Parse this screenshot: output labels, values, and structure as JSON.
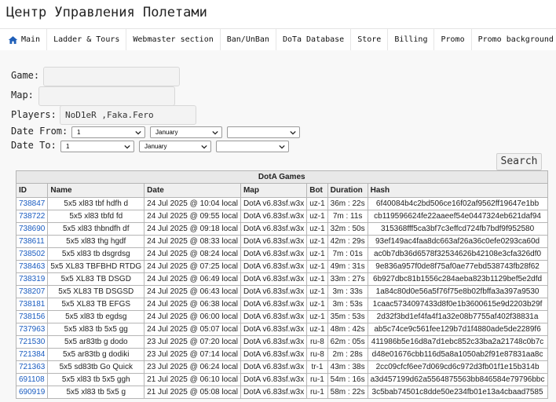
{
  "app": {
    "title": "Центр Управления Полетами"
  },
  "nav": {
    "items": [
      {
        "label": "Main",
        "icon": "home-icon"
      },
      {
        "label": "Ladder & Tours"
      },
      {
        "label": "Webmaster section"
      },
      {
        "label": "Ban/UnBan"
      },
      {
        "label": "DoTa Database"
      },
      {
        "label": "Store"
      },
      {
        "label": "Billing"
      },
      {
        "label": "Promo"
      },
      {
        "label": "Promo background"
      }
    ]
  },
  "filters": {
    "game_label": "Game:",
    "game_value": "",
    "map_label": "Map:",
    "map_value": "",
    "players_label": "Players:",
    "players_value": "NoD1eR ,Faka.Fero",
    "date_from_label": "Date From:",
    "date_from": {
      "day": "1",
      "month": "January",
      "year": ""
    },
    "date_to_label": "Date To:",
    "date_to": {
      "day": "1",
      "month": "January",
      "year": ""
    },
    "search_button": "Search"
  },
  "table": {
    "caption": "DotA Games",
    "headers": [
      "ID",
      "Name",
      "Date",
      "Map",
      "Bot",
      "Duration",
      "Hash"
    ],
    "rows": [
      [
        "738847",
        "5x5 xl83 tbf hdfh d",
        "24 Jul 2025 @ 10:04 local",
        "DotA v6.83sf.w3x",
        "uz-1",
        "36m : 22s",
        "6f40084b4c2bd506ce16f02af9562ff19647e1bb"
      ],
      [
        "738722",
        "5x5 xl83 tbfd fd",
        "24 Jul 2025 @ 09:55 local",
        "DotA v6.83sf.w3x",
        "uz-1",
        "7m : 11s",
        "cb119596624fe22aaeef54e0447324eb621daf94"
      ],
      [
        "738690",
        "5x5 xl83 thbndfh df",
        "24 Jul 2025 @ 09:18 local",
        "DotA v6.83sf.w3x",
        "uz-1",
        "32m : 50s",
        "315368fff5ca3bf7c3effcd724fb7bdf9f952580"
      ],
      [
        "738611",
        "5x5 xl83 thg hgdf",
        "24 Jul 2025 @ 08:33 local",
        "DotA v6.83sf.w3x",
        "uz-1",
        "42m : 29s",
        "93ef149ac4faa8dc663af26a36c0efe0293ca60d"
      ],
      [
        "738502",
        "5x5 xl83 tb dsgrdsg",
        "24 Jul 2025 @ 08:24 local",
        "DotA v6.83sf.w3x",
        "uz-1",
        "7m : 01s",
        "ac0b7db36d6578f32534626b42108e3cfa326df0"
      ],
      [
        "738463",
        "5x5 XL83 TBFBHD RTDG",
        "24 Jul 2025 @ 07:25 local",
        "DotA v6.83sf.w3x",
        "uz-1",
        "49m : 31s",
        "9e836a957f0de8f75af0ae77ebd538743fb28f62"
      ],
      [
        "738319",
        "5x5 XL83 TB DSGD",
        "24 Jul 2025 @ 06:49 local",
        "DotA v6.83sf.w3x",
        "uz-1",
        "33m : 27s",
        "6b927dbc81b1556c284aeba823b1129bef5e2dfd"
      ],
      [
        "738207",
        "5x5 XL83 TB DSGSD",
        "24 Jul 2025 @ 06:43 local",
        "DotA v6.83sf.w3x",
        "uz-1",
        "3m : 33s",
        "1a84c80d0e56a5f76f75e8b02fbffa3a397a9530"
      ],
      [
        "738181",
        "5x5 XL83 TB EFGS",
        "24 Jul 2025 @ 06:38 local",
        "DotA v6.83sf.w3x",
        "uz-1",
        "3m : 53s",
        "1caac5734097433d8f0e1b3600615e9d2203b29f"
      ],
      [
        "738156",
        "5x5 xl83 tb egdsg",
        "24 Jul 2025 @ 06:00 local",
        "DotA v6.83sf.w3x",
        "uz-1",
        "35m : 53s",
        "2d32f3bd1ef4fa4f1a32e08b7755af402f38831a"
      ],
      [
        "737963",
        "5x5 xl83 tb 5x5 gg",
        "24 Jul 2025 @ 05:07 local",
        "DotA v6.83sf.w3x",
        "uz-1",
        "48m : 42s",
        "ab5c74ce9c561fee129b7d1f4880ade5de2289f6"
      ],
      [
        "721530",
        "5x5 ar83tb g dodo",
        "23 Jul 2025 @ 07:20 local",
        "DotA v6.83sf.w3x",
        "ru-8",
        "62m : 05s",
        "411986b5e16d8a7d1ebc852c33ba2a21748c0b7c"
      ],
      [
        "721384",
        "5x5 ar83tb g dodiki",
        "23 Jul 2025 @ 07:14 local",
        "DotA v6.83sf.w3x",
        "ru-8",
        "2m : 28s",
        "d48e01676cbb116d5a8a1050ab2f91e87831aa8c"
      ],
      [
        "721363",
        "5x5 sd83tb Go Quick",
        "23 Jul 2025 @ 06:24 local",
        "DotA v6.83sf.w3x",
        "tr-1",
        "43m : 38s",
        "2cc09cfcf6ee7d069cd6c972d3fb01f1e15b314b"
      ],
      [
        "691108",
        "5x5 xl83 tb 5x5 ggh",
        "21 Jul 2025 @ 06:10 local",
        "DotA v6.83sf.w3x",
        "ru-1",
        "54m : 16s",
        "a3d457199d62a5564875563bb846584e79796bbc"
      ],
      [
        "690919",
        "5x5 xl83 tb 5x5 g",
        "21 Jul 2025 @ 05:08 local",
        "DotA v6.83sf.w3x",
        "ru-1",
        "58m : 22s",
        "3c5bab74501c8dde50e234fb01e13a4cbaad7585"
      ]
    ]
  },
  "colors": {
    "link": "#1a5cc0",
    "home_icon": "#1f5fb8",
    "content_bg": "#f8f8f8"
  }
}
